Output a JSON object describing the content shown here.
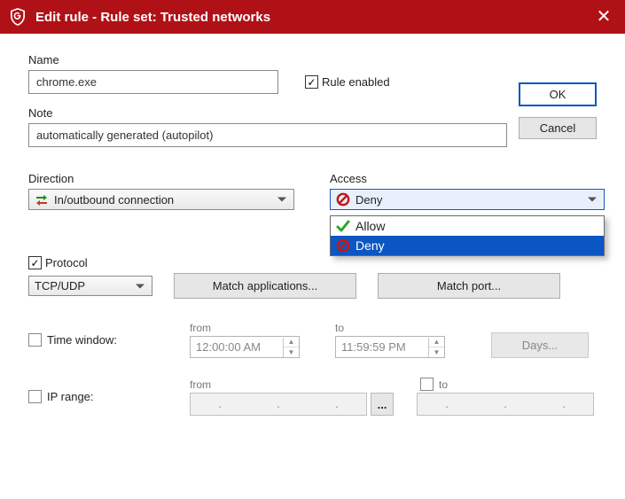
{
  "titlebar": {
    "title": "Edit rule - Rule set: Trusted networks"
  },
  "buttons": {
    "ok": "OK",
    "cancel": "Cancel",
    "match_apps": "Match applications...",
    "match_port": "Match port...",
    "days": "Days...",
    "browse": "..."
  },
  "labels": {
    "name": "Name",
    "rule_enabled": "Rule enabled",
    "note": "Note",
    "direction": "Direction",
    "access": "Access",
    "protocol": "Protocol",
    "time_window": "Time window:",
    "ip_range": "IP range:",
    "from": "from",
    "to": "to"
  },
  "values": {
    "name": "chrome.exe",
    "note": "automatically generated (autopilot)",
    "direction_selected": "In/outbound connection",
    "access_selected": "Deny",
    "protocol_selected": "TCP/UDP",
    "time_from": "12:00:00 AM",
    "time_to": "11:59:59 PM",
    "rule_enabled_checked": true,
    "protocol_checked": true,
    "time_window_checked": false,
    "ip_range_checked": false,
    "ip_to_checked": false
  },
  "access_options": [
    {
      "label": "Allow",
      "icon": "allow"
    },
    {
      "label": "Deny",
      "icon": "deny"
    }
  ],
  "icons": {
    "close": "✕",
    "check": "✓",
    "ip_sep": "."
  }
}
